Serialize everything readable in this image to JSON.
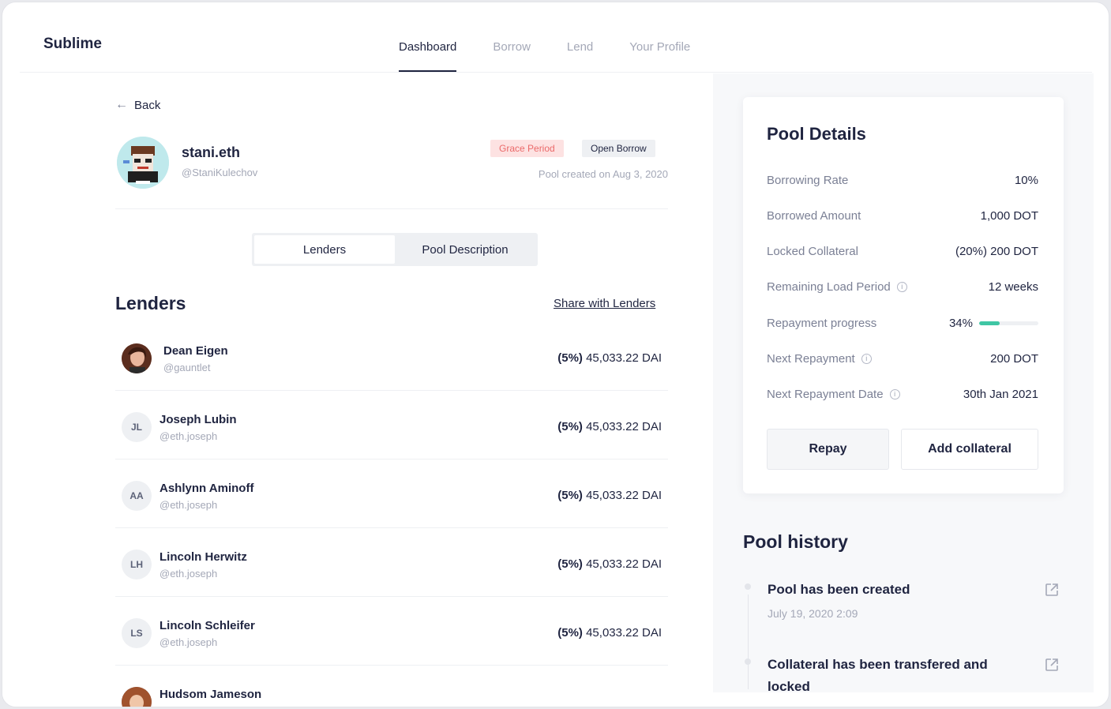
{
  "brand": "Sublime",
  "nav": [
    {
      "label": "Dashboard",
      "active": true
    },
    {
      "label": "Borrow",
      "active": false
    },
    {
      "label": "Lend",
      "active": false
    },
    {
      "label": "Your Profile",
      "active": false
    }
  ],
  "back_label": "Back",
  "profile": {
    "name": "stani.eth",
    "handle": "@StaniKulechov",
    "tag_grace": "Grace Period",
    "tag_open": "Open Borrow",
    "created": "Pool created on Aug 3, 2020"
  },
  "toggle": {
    "lenders": "Lenders",
    "description": "Pool Description"
  },
  "lenders_title": "Lenders",
  "share_label": "Share with Lenders",
  "lenders": [
    {
      "initials": "",
      "name": "Dean Eigen",
      "handle": "@gauntlet",
      "pct": "(5%)",
      "amount": "45,033.22 DAI"
    },
    {
      "initials": "JL",
      "name": "Joseph Lubin",
      "handle": "@eth.joseph",
      "pct": "(5%)",
      "amount": "45,033.22 DAI"
    },
    {
      "initials": "AA",
      "name": "Ashlynn Aminoff",
      "handle": "@eth.joseph",
      "pct": "(5%)",
      "amount": "45,033.22 DAI"
    },
    {
      "initials": "LH",
      "name": "Lincoln Herwitz",
      "handle": "@eth.joseph",
      "pct": "(5%)",
      "amount": "45,033.22 DAI"
    },
    {
      "initials": "LS",
      "name": "Lincoln Schleifer",
      "handle": "@eth.joseph",
      "pct": "(5%)",
      "amount": "45,033.22 DAI"
    },
    {
      "initials": "",
      "name": "Hudsom Jameson",
      "handle": "",
      "pct": "",
      "amount": ""
    }
  ],
  "pool_details": {
    "title": "Pool Details",
    "rows": [
      {
        "label": "Borrowing Rate",
        "value": "10%"
      },
      {
        "label": "Borrowed Amount",
        "value": "1,000 DOT"
      },
      {
        "label": "Locked Collateral",
        "value": "(20%) 200 DOT"
      },
      {
        "label": "Remaining Load Period",
        "value": "12 weeks"
      },
      {
        "label": "Repayment progress",
        "value": "34%",
        "progress": 0.34
      },
      {
        "label": "Next Repayment",
        "value": "200 DOT"
      },
      {
        "label": "Next Repayment Date",
        "value": "30th Jan 2021"
      }
    ],
    "repay_label": "Repay",
    "collateral_label": "Add collateral"
  },
  "history": {
    "title": "Pool history",
    "items": [
      {
        "text": "Pool has been created",
        "date": "July 19, 2020 2:09"
      },
      {
        "text": "Collateral has been transfered and locked",
        "date": ""
      }
    ]
  },
  "colors": {
    "accent": "#1f2440",
    "progress": "#3fc6a4",
    "grace_bg": "#fde2e2",
    "grace_text": "#eb6a6a"
  }
}
